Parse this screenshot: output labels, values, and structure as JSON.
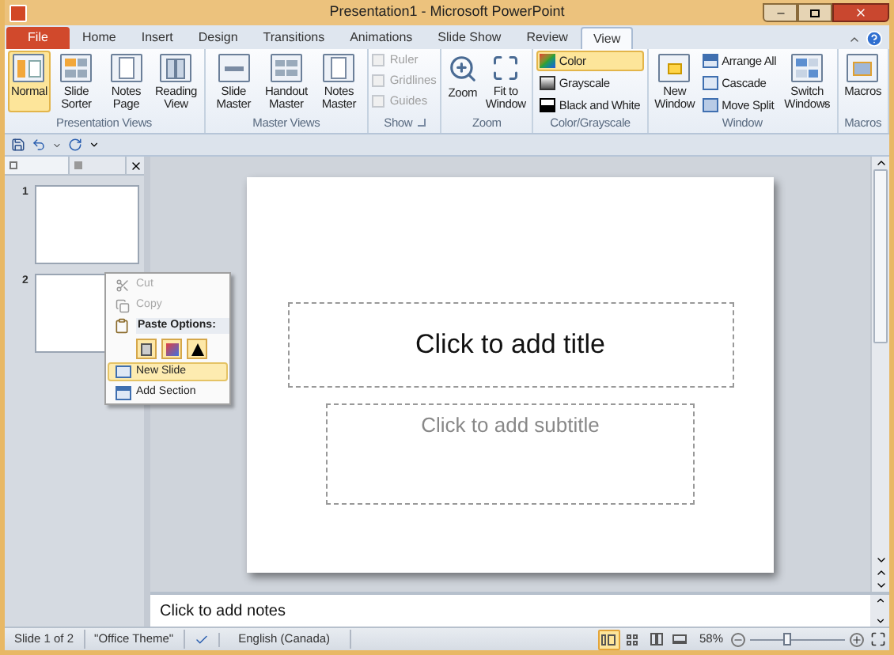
{
  "window": {
    "title": "Presentation1 - Microsoft PowerPoint"
  },
  "tabs": [
    {
      "label": "File",
      "kind": "file",
      "selected": false
    },
    {
      "label": "Home",
      "kind": "tab",
      "selected": false
    },
    {
      "label": "Insert",
      "kind": "tab",
      "selected": false
    },
    {
      "label": "Design",
      "kind": "tab",
      "selected": false
    },
    {
      "label": "Transitions",
      "kind": "tab",
      "selected": false
    },
    {
      "label": "Animations",
      "kind": "tab",
      "selected": false
    },
    {
      "label": "Slide Show",
      "kind": "tab",
      "selected": false
    },
    {
      "label": "Review",
      "kind": "tab",
      "selected": false
    },
    {
      "label": "View",
      "kind": "tab",
      "selected": true
    }
  ],
  "ribbon_groups": [
    {
      "label": "Presentation Views",
      "items": [
        {
          "kind": "large",
          "label": "Normal",
          "selected": true
        },
        {
          "kind": "large",
          "label": "Slide Sorter",
          "selected": false
        },
        {
          "kind": "large",
          "label": "Notes Page",
          "selected": false
        },
        {
          "kind": "large",
          "label": "Reading View",
          "selected": false
        }
      ]
    },
    {
      "label": "Master Views",
      "items": [
        {
          "kind": "large",
          "label": "Slide Master",
          "selected": false
        },
        {
          "kind": "large",
          "label": "Handout Master",
          "selected": false
        },
        {
          "kind": "large",
          "label": "Notes Master",
          "selected": false
        }
      ]
    },
    {
      "label": "Show",
      "launcher": true,
      "items": [
        {
          "kind": "check",
          "label": "Ruler",
          "checked": false,
          "disabled": true
        },
        {
          "kind": "check",
          "label": "Gridlines",
          "checked": false,
          "disabled": true
        },
        {
          "kind": "check",
          "label": "Guides",
          "checked": false,
          "disabled": true
        }
      ]
    },
    {
      "label": "Zoom",
      "items": [
        {
          "kind": "large",
          "label": "Zoom",
          "selected": false
        },
        {
          "kind": "large",
          "label": "Fit to Window",
          "selected": false
        }
      ]
    },
    {
      "label": "Color/Grayscale",
      "items": [
        {
          "kind": "small",
          "label": "Color",
          "selected": true
        },
        {
          "kind": "small",
          "label": "Grayscale",
          "selected": false
        },
        {
          "kind": "small",
          "label": "Black and White",
          "selected": false
        }
      ]
    },
    {
      "label": "Window",
      "items": [
        {
          "kind": "large",
          "label": "New Window",
          "selected": false
        },
        {
          "kind": "small",
          "label": "Arrange All",
          "selected": false
        },
        {
          "kind": "small",
          "label": "Cascade",
          "selected": false
        },
        {
          "kind": "small",
          "label": "Move Split",
          "selected": false
        },
        {
          "kind": "large",
          "label": "Switch Windows",
          "dropdown": true,
          "selected": false
        }
      ]
    },
    {
      "label": "Macros",
      "items": [
        {
          "kind": "large",
          "label": "Macros",
          "selected": false
        }
      ]
    }
  ],
  "thumbnails": [
    "1",
    "2"
  ],
  "context_menu": [
    {
      "kind": "item",
      "label": "Cut",
      "disabled": true,
      "selected": false
    },
    {
      "kind": "item",
      "label": "Copy",
      "disabled": true,
      "selected": false
    },
    {
      "kind": "header",
      "label": "Paste Options:"
    },
    {
      "kind": "paste"
    },
    {
      "kind": "item",
      "label": "New Slide",
      "disabled": false,
      "selected": true
    },
    {
      "kind": "item",
      "label": "Add Section",
      "disabled": false,
      "selected": false
    }
  ],
  "slide": {
    "title_placeholder": "Click to add title",
    "subtitle_placeholder": "Click to add subtitle"
  },
  "notes": {
    "placeholder": "Click to add notes"
  },
  "status_bar": {
    "slide": "Slide 1 of 2",
    "theme": "\"Office Theme\"",
    "language": "English (Canada)",
    "views": [
      {
        "kind": "normal",
        "selected": true
      },
      {
        "kind": "sorter",
        "selected": false
      },
      {
        "kind": "reading",
        "selected": false
      },
      {
        "kind": "show",
        "selected": false
      }
    ],
    "zoom": "58%",
    "zoom_level": {
      "level": 0.38
    }
  }
}
